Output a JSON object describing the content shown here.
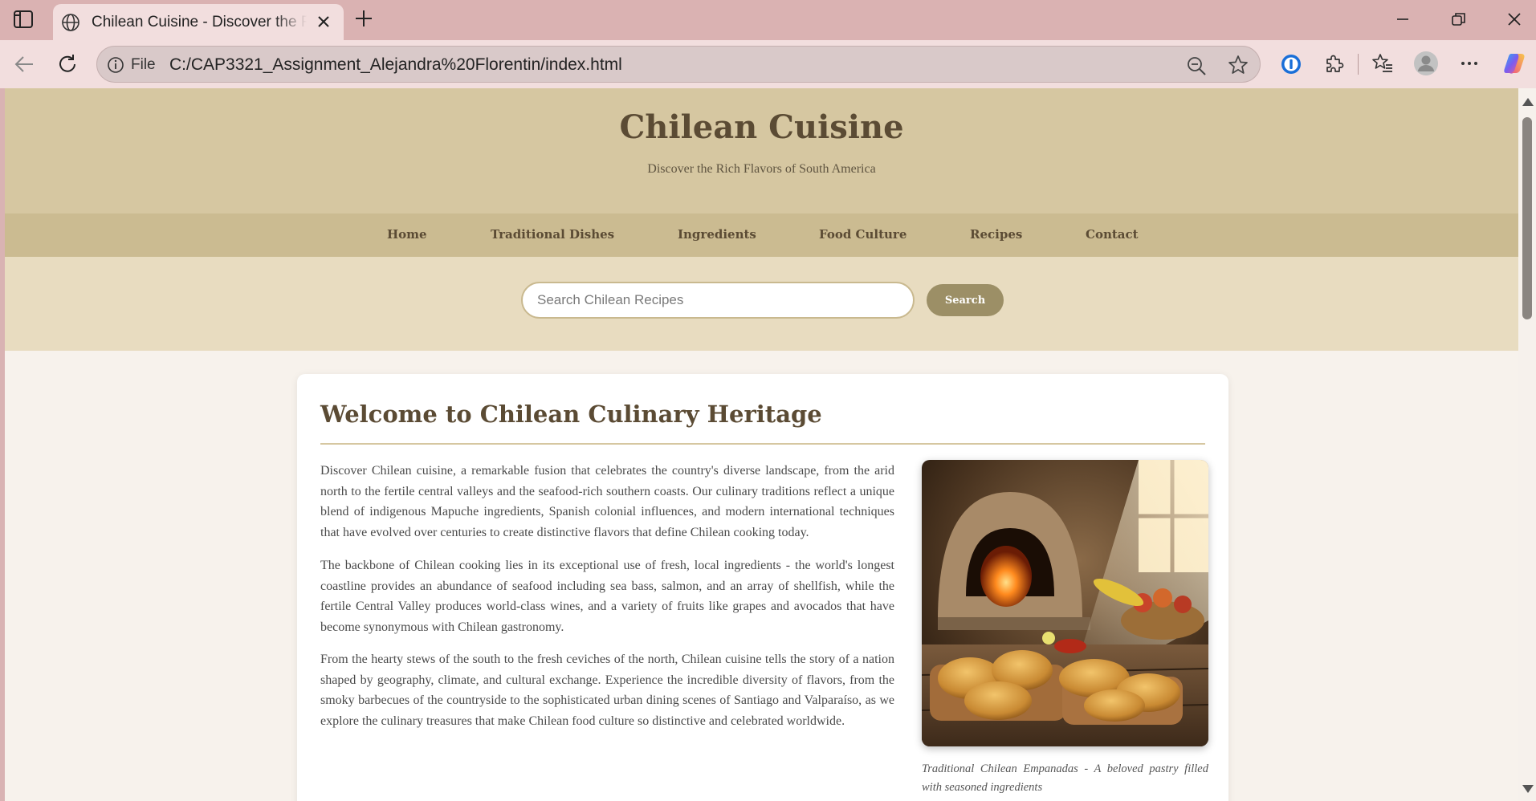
{
  "browser": {
    "tab_title": "Chilean Cuisine - Discover the Rich Flavors of South America",
    "file_label": "File",
    "url": "C:/CAP3321_Assignment_Alejandra%20Florentin/index.html"
  },
  "site": {
    "title": "Chilean Cuisine",
    "subtitle": "Discover the Rich Flavors of South America",
    "nav": [
      "Home",
      "Traditional Dishes",
      "Ingredients",
      "Food Culture",
      "Recipes",
      "Contact"
    ],
    "search": {
      "placeholder": "Search Chilean Recipes",
      "button_label": "Search"
    }
  },
  "main": {
    "heading": "Welcome to Chilean Culinary Heritage",
    "paragraphs": [
      "Discover Chilean cuisine, a remarkable fusion that celebrates the country's diverse landscape, from the arid north to the fertile central valleys and the seafood-rich southern coasts. Our culinary traditions reflect a unique blend of indigenous Mapuche ingredients, Spanish colonial influences, and modern international techniques that have evolved over centuries to create distinctive flavors that define Chilean cooking today.",
      "The backbone of Chilean cooking lies in its exceptional use of fresh, local ingredients - the world's longest coastline provides an abundance of seafood including sea bass, salmon, and an array of shellfish, while the fertile Central Valley produces world-class wines, and a variety of fruits like grapes and avocados that have become synonymous with Chilean gastronomy.",
      "From the hearty stews of the south to the fresh ceviches of the north, Chilean cuisine tells the story of a nation shaped by geography, climate, and cultural exchange. Experience the incredible diversity of flavors, from the smoky barbecues of the countryside to the sophisticated urban dining scenes of Santiago and Valparaíso, as we explore the culinary treasures that make Chilean food culture so distinctive and celebrated worldwide."
    ],
    "image_caption": "Traditional Chilean Empanadas - A beloved pastry filled with seasoned ingredients"
  },
  "colors": {
    "header_bg": "#d6c7a1",
    "nav_bg": "#cbbb91",
    "search_band_bg": "#e8dcc0",
    "accent": "#9c8f66",
    "heading_text": "#5b4b34",
    "page_bg": "#f7f2ec",
    "tab_strip": "#dab2b2"
  },
  "icons": [
    "sidebar-toggle-icon",
    "globe-icon",
    "close-icon",
    "plus-icon",
    "minimize-icon",
    "restore-icon",
    "back-arrow-icon",
    "reload-icon",
    "info-icon",
    "zoom-out-icon",
    "star-icon",
    "password-manager-icon",
    "puzzle-icon",
    "favorites-icon",
    "profile-icon",
    "more-icon",
    "copilot-icon"
  ]
}
